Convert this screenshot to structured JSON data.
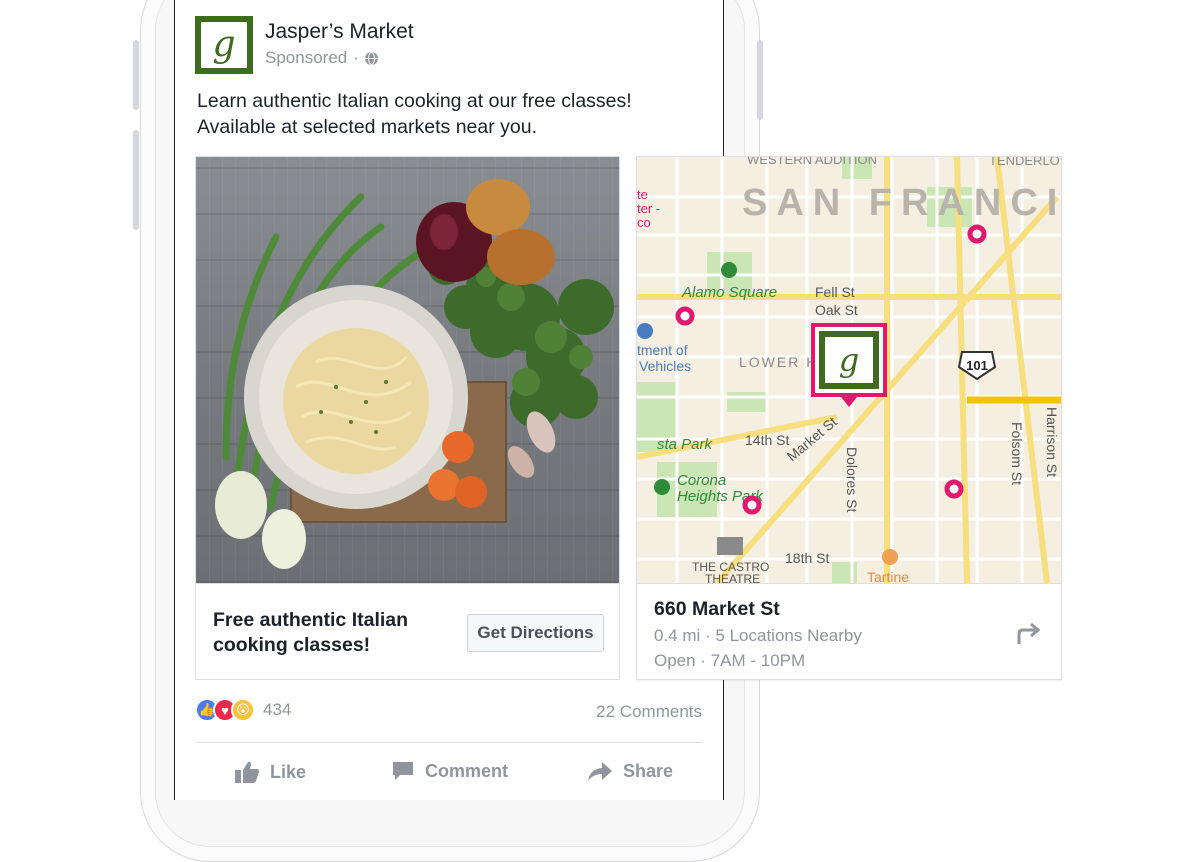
{
  "post": {
    "page_name": "Jasper’s Market",
    "sponsored": "Sponsored",
    "separator": "·",
    "avatar_letter": "g",
    "text": "Learn authentic Italian cooking at our free classes!\nAvailable at selected markets near you."
  },
  "cards": [
    {
      "headline": "Free authentic Italian cooking classes!",
      "cta": "Get Directions"
    },
    {
      "address": "660 Market St",
      "distance_line": "0.4 mi · 5 Locations Nearby",
      "hours_line": "Open · 7AM - 10PM",
      "map": {
        "labels": {
          "western_addition": "WESTERN ADDITION",
          "tenderloin": "TENDERLO",
          "san_francisco": "SAN FRANCI",
          "alamo_square": "Alamo Square",
          "fell_st": "Fell St",
          "oak_st": "Oak St",
          "lower_h": "LOWER H",
          "dept_of": "tment of",
          "vehicles": "Vehicles",
          "highway": "101",
          "fourteenth_st": "14th St",
          "market_st": "Market St",
          "dolores_st": "Dolores St",
          "folsom_st": "Folsom St",
          "harrison_st": "Harrison St",
          "sta_park": "sta Park",
          "corona": "Corona",
          "heights_park": "Heights Park",
          "eighteenth_st": "18th St",
          "castro_theatre_1": "THE CASTRO",
          "castro_theatre_2": "THEATRE",
          "tartine": "Tartine",
          "ste": "te",
          "ter": "ter -",
          "co": "co"
        }
      }
    }
  ],
  "reactions": {
    "count": "434",
    "comments": "22 Comments"
  },
  "actions": {
    "like": "Like",
    "comment": "Comment",
    "share": "Share"
  },
  "colors": {
    "brand_green": "#3f6b1f",
    "pin_pink": "#e0196e",
    "like_blue": "#4a7bf0",
    "love_red": "#f0284a",
    "wow_yellow": "#f7c23e"
  }
}
